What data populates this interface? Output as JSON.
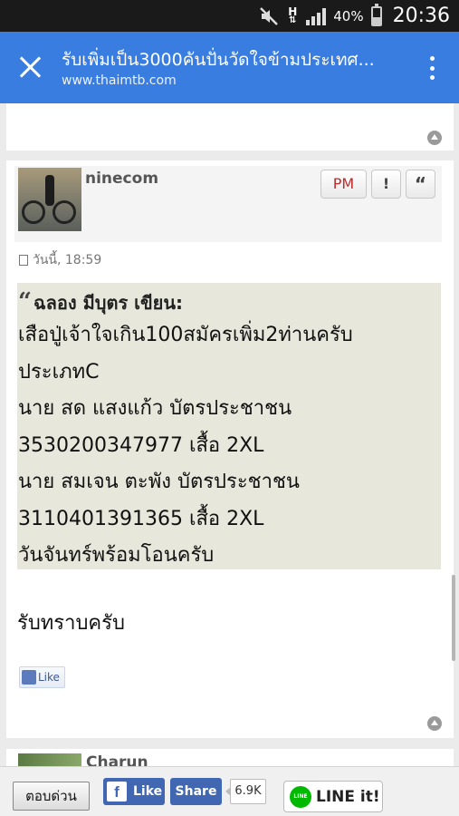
{
  "status_bar": {
    "network": "H",
    "battery_percent": "40%",
    "time": "20:36",
    "icons": [
      "mute-icon",
      "signal-icon",
      "battery-icon"
    ]
  },
  "app_bar": {
    "title": "รับเพิ่มเป็น3000คันปั่นวัดใจข้ามประเทศ...",
    "url": "www.thaimtb.com"
  },
  "post": {
    "username": "ninecom",
    "buttons": {
      "pm": "PM",
      "report": "!",
      "quote": "“"
    },
    "date": "วันนี้, 18:59",
    "quote": {
      "header": "ฉลอง มีบุตร เขียน:",
      "lines": [
        "เสือปู่เจ้าใจเกิน100สมัครเพิ่ม2ท่านครับ",
        "ประเภทC",
        "นาย สด แสงแก้ว บัตรประชาชน",
        "3530200347977 เสื้อ 2XL",
        "นาย สมเจน ตะพัง บัตรประชาชน",
        "3110401391365 เสื้อ 2XL",
        "วันจันทร์พร้อมโอนครับ"
      ]
    },
    "reply_text": "รับทราบครับ",
    "like_label": "Like"
  },
  "next_post": {
    "username": "Charun"
  },
  "bottom_bar": {
    "quick_reply": "ตอบด่วน",
    "fb_like": "Like",
    "fb_share": "Share",
    "fb_count": "6.9K",
    "line_it": "LINE it!",
    "line_icon_text": "LINE"
  },
  "colors": {
    "app_bar": "#3a7de0",
    "quote_bg": "#e8e7dc",
    "facebook": "#4267b2",
    "line": "#00b900"
  }
}
